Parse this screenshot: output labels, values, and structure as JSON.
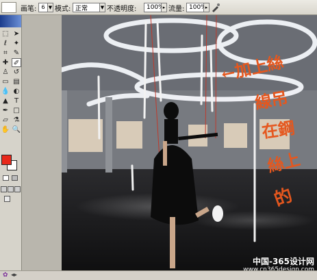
{
  "options_bar": {
    "brush_label": "画笔:",
    "brush_size": "6",
    "mode_label": "模式:",
    "mode_value": "正常",
    "opacity_label": "不透明度:",
    "opacity_value": "100%",
    "flow_label": "流量:",
    "flow_value": "100%"
  },
  "colors": {
    "foreground": "#e8281a",
    "background": "#ffffff",
    "annotation": "#e5571e"
  },
  "annotation": {
    "arrow_text": "←",
    "lines": [
      "加上絲",
      "線吊",
      "在鋼",
      "絲上",
      "的"
    ]
  },
  "watermark": {
    "title": "中国-365设计网",
    "url": "www.cn365design.com"
  }
}
